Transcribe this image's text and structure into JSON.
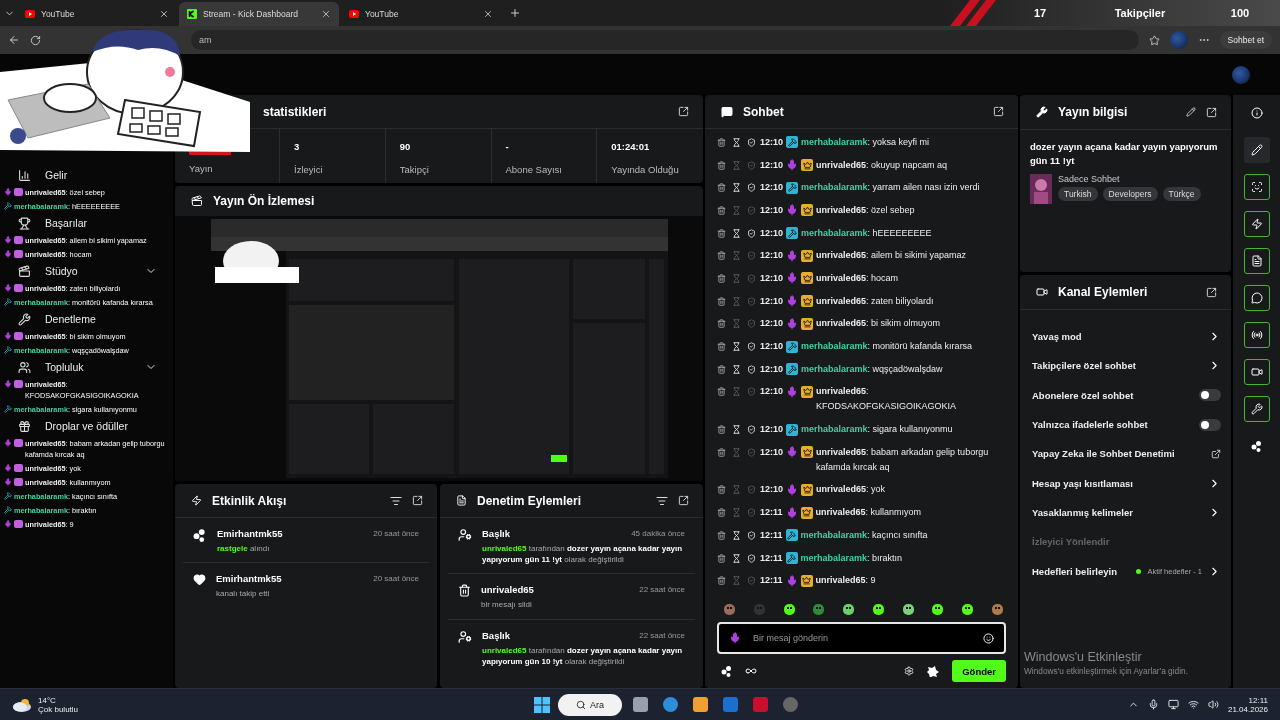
{
  "browser": {
    "tabs": [
      {
        "title": "YouTube",
        "kind": "youtube",
        "selected": false
      },
      {
        "title": "Stream - Kick Dashboard",
        "kind": "kick",
        "selected": true
      },
      {
        "title": "YouTube",
        "kind": "youtube",
        "selected": false
      }
    ],
    "address_fragment": "am",
    "assistant_label": "Sohbet et"
  },
  "follower_goal": {
    "current": "17",
    "label": "Takipçiler",
    "target": "100"
  },
  "sidebar": {
    "items": [
      {
        "label": "Gelir",
        "kind": "revenue",
        "has_children": false
      },
      {
        "label": "Başarılar",
        "kind": "trophy",
        "has_children": false
      },
      {
        "label": "Stüdyo",
        "kind": "studio",
        "has_children": true
      },
      {
        "label": "Denetleme",
        "kind": "moderation",
        "has_children": false
      },
      {
        "label": "Topluluk",
        "kind": "community",
        "has_children": true
      },
      {
        "label": "Droplar ve ödüller",
        "kind": "drops",
        "has_children": false
      }
    ]
  },
  "chat_overlay": {
    "messages": [
      {
        "kind": "owner",
        "user": "unrivaled65",
        "color": "#eeeeee",
        "text": ": özel sebep"
      },
      {
        "kind": "mod",
        "user": "merhabalaramk",
        "color": "#3fd1a4",
        "text": ": hEEEEEEEEE"
      },
      {
        "kind": "owner",
        "user": "unrivaled65",
        "color": "#eeeeee",
        "text": ": ailem bi sikimi yapamaz"
      },
      {
        "kind": "owner",
        "user": "unrivaled65",
        "color": "#eeeeee",
        "text": ": hocam"
      },
      {
        "kind": "owner",
        "user": "unrivaled65",
        "color": "#eeeeee",
        "text": ": zaten biliyolardı"
      },
      {
        "kind": "mod",
        "user": "merhabalaramk",
        "color": "#3fd1a4",
        "text": ": monitörü kafanda kırarsa"
      },
      {
        "kind": "owner",
        "user": "unrivaled65",
        "color": "#eeeeee",
        "text": ": bi sikim olmuyom"
      },
      {
        "kind": "mod",
        "user": "merhabalaramk",
        "color": "#3fd1a4",
        "text": ": wqşçadöwalşdaw"
      },
      {
        "kind": "owner",
        "user": "unrivaled65",
        "color": "#eeeeee",
        "text": ": KFODSAKOFGKASIGOIKAGOKIA"
      },
      {
        "kind": "mod",
        "user": "merhabalaramk",
        "color": "#3fd1a4",
        "text": ": sigara kullanıyonmu"
      },
      {
        "kind": "owner",
        "user": "unrivaled65",
        "color": "#eeeeee",
        "text": ": babam arkadan gelip tuborgu kafamda kırcak aq"
      },
      {
        "kind": "owner",
        "user": "unrivaled65",
        "color": "#eeeeee",
        "text": ": yok"
      },
      {
        "kind": "owner",
        "user": "unrivaled65",
        "color": "#eeeeee",
        "text": ": kullanmıyom"
      },
      {
        "kind": "mod",
        "user": "merhabalaramk",
        "color": "#3fd1a4",
        "text": ": kaçıncı sınıfta"
      },
      {
        "kind": "mod",
        "user": "merhabalaramk",
        "color": "#3fd1a4",
        "text": ": bıraktın"
      },
      {
        "kind": "owner",
        "user": "unrivaled65",
        "color": "#eeeeee",
        "text": ": 9"
      }
    ]
  },
  "stats": {
    "title": "statistikleri",
    "stream_label": "Yayın",
    "items": [
      {
        "value": "3",
        "label": "İzleyici"
      },
      {
        "value": "90",
        "label": "Takipçi"
      },
      {
        "value": "-",
        "label": "Abone Sayısı"
      },
      {
        "value": "01:24:01",
        "label": "Yayında Olduğu"
      }
    ]
  },
  "preview": {
    "title": "Yayın Ön İzlemesi"
  },
  "activity": {
    "title": "Etkinlik Akışı",
    "events": [
      {
        "kind": "points",
        "user": "Emirhantmk55",
        "time": "20 saat önce",
        "highlight": "rastgele",
        "text": "alındı"
      },
      {
        "kind": "follow",
        "user": "Emirhantmk55",
        "time": "20 saat önce",
        "text": "kanalı takip etti"
      }
    ]
  },
  "moderation": {
    "title": "Denetim Eylemleri",
    "entries": [
      {
        "kind": "title",
        "heading": "Başlık",
        "time": "45 dakika önce",
        "actor": "unrivaled65",
        "verb": "tarafından",
        "value": "dozer yayın açana kadar yayın yapıyorum gün 11 !yt",
        "suffix": "olarak değiştirildi"
      },
      {
        "kind": "delete",
        "heading": "unrivaled65",
        "time": "22 saat önce",
        "suffix": "bir mesajı sildi"
      },
      {
        "kind": "title",
        "heading": "Başlık",
        "time": "22 saat önce",
        "actor": "unrivaled65",
        "verb": "tarafından",
        "value": "dozer yayın açana kadar yayın yapıyorum gün 10 !yt",
        "suffix": "olarak değiştirildi"
      }
    ]
  },
  "chat": {
    "title": "Sohbet",
    "messages": [
      {
        "kind": "mod",
        "time": "12:10",
        "user": "merhabalaramk",
        "color": "#3fd1a4",
        "text": ": yoksa keyfi mi"
      },
      {
        "kind": "owner",
        "time": "12:10",
        "user": "unrivaled65",
        "color": "#eeeeee",
        "text": ": okuyup napcam aq"
      },
      {
        "kind": "mod",
        "time": "12:10",
        "user": "merhabalaramk",
        "color": "#3fd1a4",
        "text": ": yarram ailen nası izin verdi"
      },
      {
        "kind": "owner",
        "time": "12:10",
        "user": "unrivaled65",
        "color": "#eeeeee",
        "text": ": özel sebep"
      },
      {
        "kind": "mod",
        "time": "12:10",
        "user": "merhabalaramk",
        "color": "#3fd1a4",
        "text": ": hEEEEEEEEE"
      },
      {
        "kind": "owner",
        "time": "12:10",
        "user": "unrivaled65",
        "color": "#eeeeee",
        "text": ": ailem bi sikimi yapamaz"
      },
      {
        "kind": "owner",
        "time": "12:10",
        "user": "unrivaled65",
        "color": "#eeeeee",
        "text": ": hocam"
      },
      {
        "kind": "owner",
        "time": "12:10",
        "user": "unrivaled65",
        "color": "#eeeeee",
        "text": ": zaten biliyolardı"
      },
      {
        "kind": "owner",
        "time": "12:10",
        "user": "unrivaled65",
        "color": "#eeeeee",
        "text": ": bi sikim olmuyom"
      },
      {
        "kind": "mod",
        "time": "12:10",
        "user": "merhabalaramk",
        "color": "#3fd1a4",
        "text": ": monitörü kafanda kırarsa"
      },
      {
        "kind": "mod",
        "time": "12:10",
        "user": "merhabalaramk",
        "color": "#3fd1a4",
        "text": ": wqşçadöwalşdaw"
      },
      {
        "kind": "owner",
        "time": "12:10",
        "user": "unrivaled65",
        "color": "#eeeeee",
        "text": ": KFODSAKOFGKASIGOIKAGOKIA"
      },
      {
        "kind": "mod",
        "time": "12:10",
        "user": "merhabalaramk",
        "color": "#3fd1a4",
        "text": ": sigara kullanıyonmu"
      },
      {
        "kind": "owner",
        "time": "12:10",
        "user": "unrivaled65",
        "color": "#eeeeee",
        "text": ": babam arkadan gelip tuborgu kafamda kırcak aq"
      },
      {
        "kind": "owner",
        "time": "12:10",
        "user": "unrivaled65",
        "color": "#eeeeee",
        "text": ": yok"
      },
      {
        "kind": "owner",
        "time": "12:11",
        "user": "unrivaled65",
        "color": "#eeeeee",
        "text": ": kullanmıyom"
      },
      {
        "kind": "mod",
        "time": "12:11",
        "user": "merhabalaramk",
        "color": "#3fd1a4",
        "text": ": kaçıncı sınıfta"
      },
      {
        "kind": "mod",
        "time": "12:11",
        "user": "merhabalaramk",
        "color": "#3fd1a4",
        "text": ": bıraktın"
      },
      {
        "kind": "owner",
        "time": "12:11",
        "user": "unrivaled65",
        "color": "#eeeeee",
        "text": ": 9"
      }
    ],
    "input": {
      "placeholder": "Bir mesaj gönderin"
    },
    "send_label": "Gönder"
  },
  "stream_info": {
    "title": "Yayın bilgisi",
    "stream_title": "dozer yayın açana kadar yayın yapıyorum gün 11 !yt",
    "category": "Sadece Sohbet",
    "tags": [
      "Turkish",
      "Developers",
      "Türkçe"
    ]
  },
  "channel_actions": {
    "title": "Kanal Eylemleri",
    "items": [
      {
        "kind": "link",
        "label": "Yavaş mod"
      },
      {
        "kind": "link",
        "label": "Takipçilere özel sohbet"
      },
      {
        "kind": "toggle",
        "label": "Abonelere özel sohbet",
        "on": false
      },
      {
        "kind": "toggle",
        "label": "Yalnızca ifadelerle sohbet",
        "on": false
      },
      {
        "kind": "external",
        "label": "Yapay Zeka ile Sohbet Denetimi"
      },
      {
        "kind": "link",
        "label": "Hesap yaşı kısıtlaması"
      },
      {
        "kind": "link",
        "label": "Yasaklanmış kelimeler"
      },
      {
        "kind": "section",
        "label": "İzleyici Yönlendir"
      },
      {
        "kind": "goal",
        "label": "Hedefleri belirleyin",
        "note": "Aktif hedefler - 1",
        "color": "#53fc18"
      }
    ]
  },
  "rail": {
    "items": [
      {
        "kind": "info",
        "selected": false,
        "on": false
      },
      {
        "kind": "edit",
        "selected": true,
        "on": false
      },
      {
        "kind": "capture",
        "selected": false,
        "on": true
      },
      {
        "kind": "zap",
        "selected": false,
        "on": true
      },
      {
        "kind": "notes",
        "selected": false,
        "on": true
      },
      {
        "kind": "chat",
        "selected": false,
        "on": true
      },
      {
        "kind": "broadcast",
        "selected": false,
        "on": true
      },
      {
        "kind": "video",
        "selected": false,
        "on": true
      },
      {
        "kind": "wrench",
        "selected": false,
        "on": true
      },
      {
        "kind": "points",
        "selected": false,
        "on": false
      }
    ]
  },
  "activation": {
    "title": "Windows'u Etkinleştir",
    "text": "Windows'u etkinleştirmek için Ayarlar'a gidin."
  },
  "taskbar": {
    "temperature": "14°C",
    "weather": "Çok bulutlu",
    "search_label": "Ara",
    "time": "12:11",
    "date": "21.04.2026"
  }
}
